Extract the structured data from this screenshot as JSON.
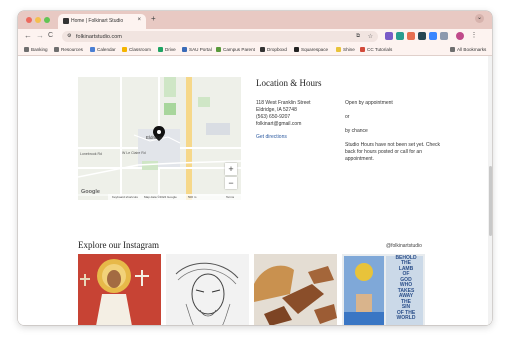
{
  "browser": {
    "tab_title": "Home | Folkinart Studio",
    "tab_close": "×",
    "new_tab": "+",
    "url": "folkinartstudio.com",
    "back": "←",
    "forward": "→",
    "reload": "C",
    "bookmarks": [
      {
        "label": "Banking",
        "color": "#6e6e6e"
      },
      {
        "label": "Resources",
        "color": "#6e6e6e"
      },
      {
        "label": "Calendar",
        "color": "#4a7fd4"
      },
      {
        "label": "Classroom",
        "color": "#f4b400"
      },
      {
        "label": "Drive",
        "color": "#1fa463"
      },
      {
        "label": "SAU Portal",
        "color": "#3a6bb8"
      },
      {
        "label": "Campus Parent",
        "color": "#5a9a3c"
      },
      {
        "label": "Dropboxd",
        "color": "#333333"
      },
      {
        "label": "Squarespace",
        "color": "#222222"
      },
      {
        "label": "Shine",
        "color": "#e8c33a"
      },
      {
        "label": "CC Tutorials",
        "color": "#d24a3a"
      }
    ],
    "all_bookmarks": "All Bookmarks"
  },
  "location": {
    "heading": "Location & Hours",
    "address_lines": [
      "118 West Franklin Street",
      "Eldridge, IA 52748",
      "(563) 650-9207",
      "folkinart@gmail.com"
    ],
    "directions_link": "Get directions",
    "hours": [
      "Open by appointment",
      "or",
      "by chance",
      "Studio Hours have not been set yet. Check back for hours posted or call for an appointment."
    ]
  },
  "map": {
    "zoom_in": "+",
    "zoom_out": "−",
    "logo": "Google",
    "attribution": [
      "Keyboard shortcuts",
      "Map data ©2024 Google",
      "500 m",
      "Terms"
    ],
    "labels": [
      "Eldridge",
      "Lonebrook Rd",
      "W Le Claire Rd"
    ]
  },
  "instagram": {
    "heading": "Explore our Instagram",
    "handle": "@folkinartstudio",
    "photo4_text": [
      "BEHOLD",
      "THE",
      "LAMB",
      "OF",
      "GOD",
      "WHO",
      "TAKES",
      "AWAY",
      "THE",
      "SIN",
      "OF THE",
      "WORLD"
    ]
  }
}
